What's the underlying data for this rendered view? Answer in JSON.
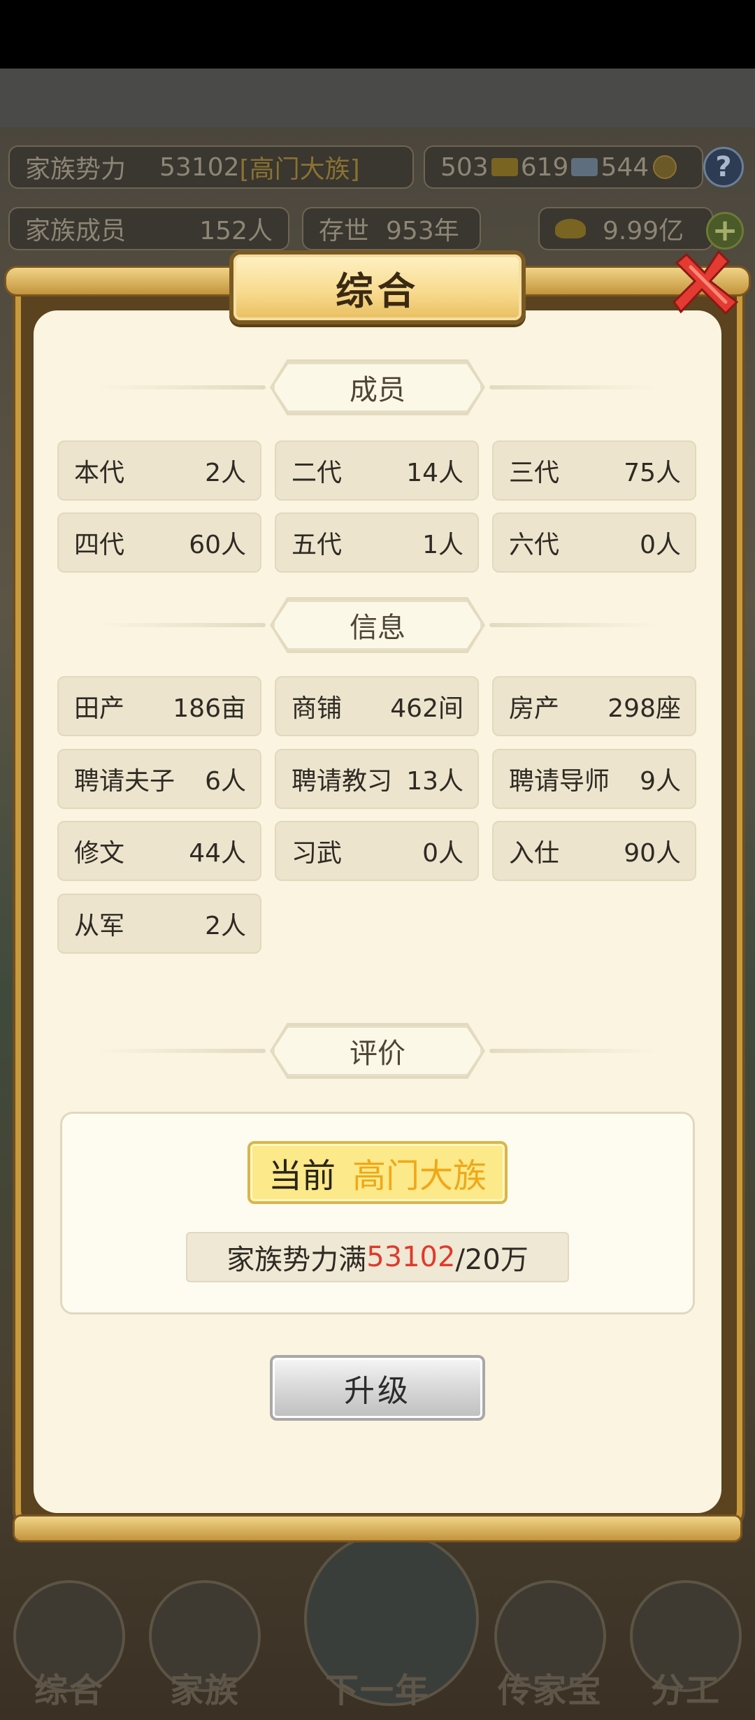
{
  "background": {
    "top_row": {
      "clan_power_label": "家族势力",
      "clan_power_value": "53102",
      "clan_rank": "[高门大族]",
      "res_a": "503",
      "res_b": "619",
      "res_c": "544",
      "help_label": "?"
    },
    "second_row": {
      "members_label": "家族成员",
      "members_value": "152人",
      "years_label": "存世",
      "years_value": "953年",
      "gold_value": "9.99亿",
      "plus_label": "+"
    },
    "nav": [
      {
        "label": "综合"
      },
      {
        "label": "家族"
      },
      {
        "label": "下一年"
      },
      {
        "label": "传家宝"
      },
      {
        "label": "分工"
      }
    ]
  },
  "dialog": {
    "title": "综合",
    "members_section": {
      "title": "成员",
      "stats": [
        {
          "label": "本代",
          "value": "2人"
        },
        {
          "label": "二代",
          "value": "14人"
        },
        {
          "label": "三代",
          "value": "75人"
        },
        {
          "label": "四代",
          "value": "60人"
        },
        {
          "label": "五代",
          "value": "1人"
        },
        {
          "label": "六代",
          "value": "0人"
        }
      ]
    },
    "info_section": {
      "title": "信息",
      "stats": [
        {
          "label": "田产",
          "value": "186亩"
        },
        {
          "label": "商铺",
          "value": "462间"
        },
        {
          "label": "房产",
          "value": "298座"
        },
        {
          "label": "聘请夫子",
          "value": "6人"
        },
        {
          "label": "聘请教习",
          "value": "13人"
        },
        {
          "label": "聘请导师",
          "value": "9人"
        },
        {
          "label": "修文",
          "value": "44人"
        },
        {
          "label": "习武",
          "value": "0人"
        },
        {
          "label": "入仕",
          "value": "90人"
        },
        {
          "label": "从军",
          "value": "2人"
        }
      ]
    },
    "evaluation_section": {
      "title": "评价",
      "current_label": "当前",
      "current_rank": "高门大族",
      "power_label": "家族势力满",
      "power_current": "53102",
      "power_target": "/20万",
      "upgrade_label": "升级"
    }
  },
  "colors": {
    "accent_gold": "#f0a818",
    "power_red": "#e03a2c",
    "panel_bg": "#fbf4e0",
    "frame_gold": "#c99a3c"
  }
}
